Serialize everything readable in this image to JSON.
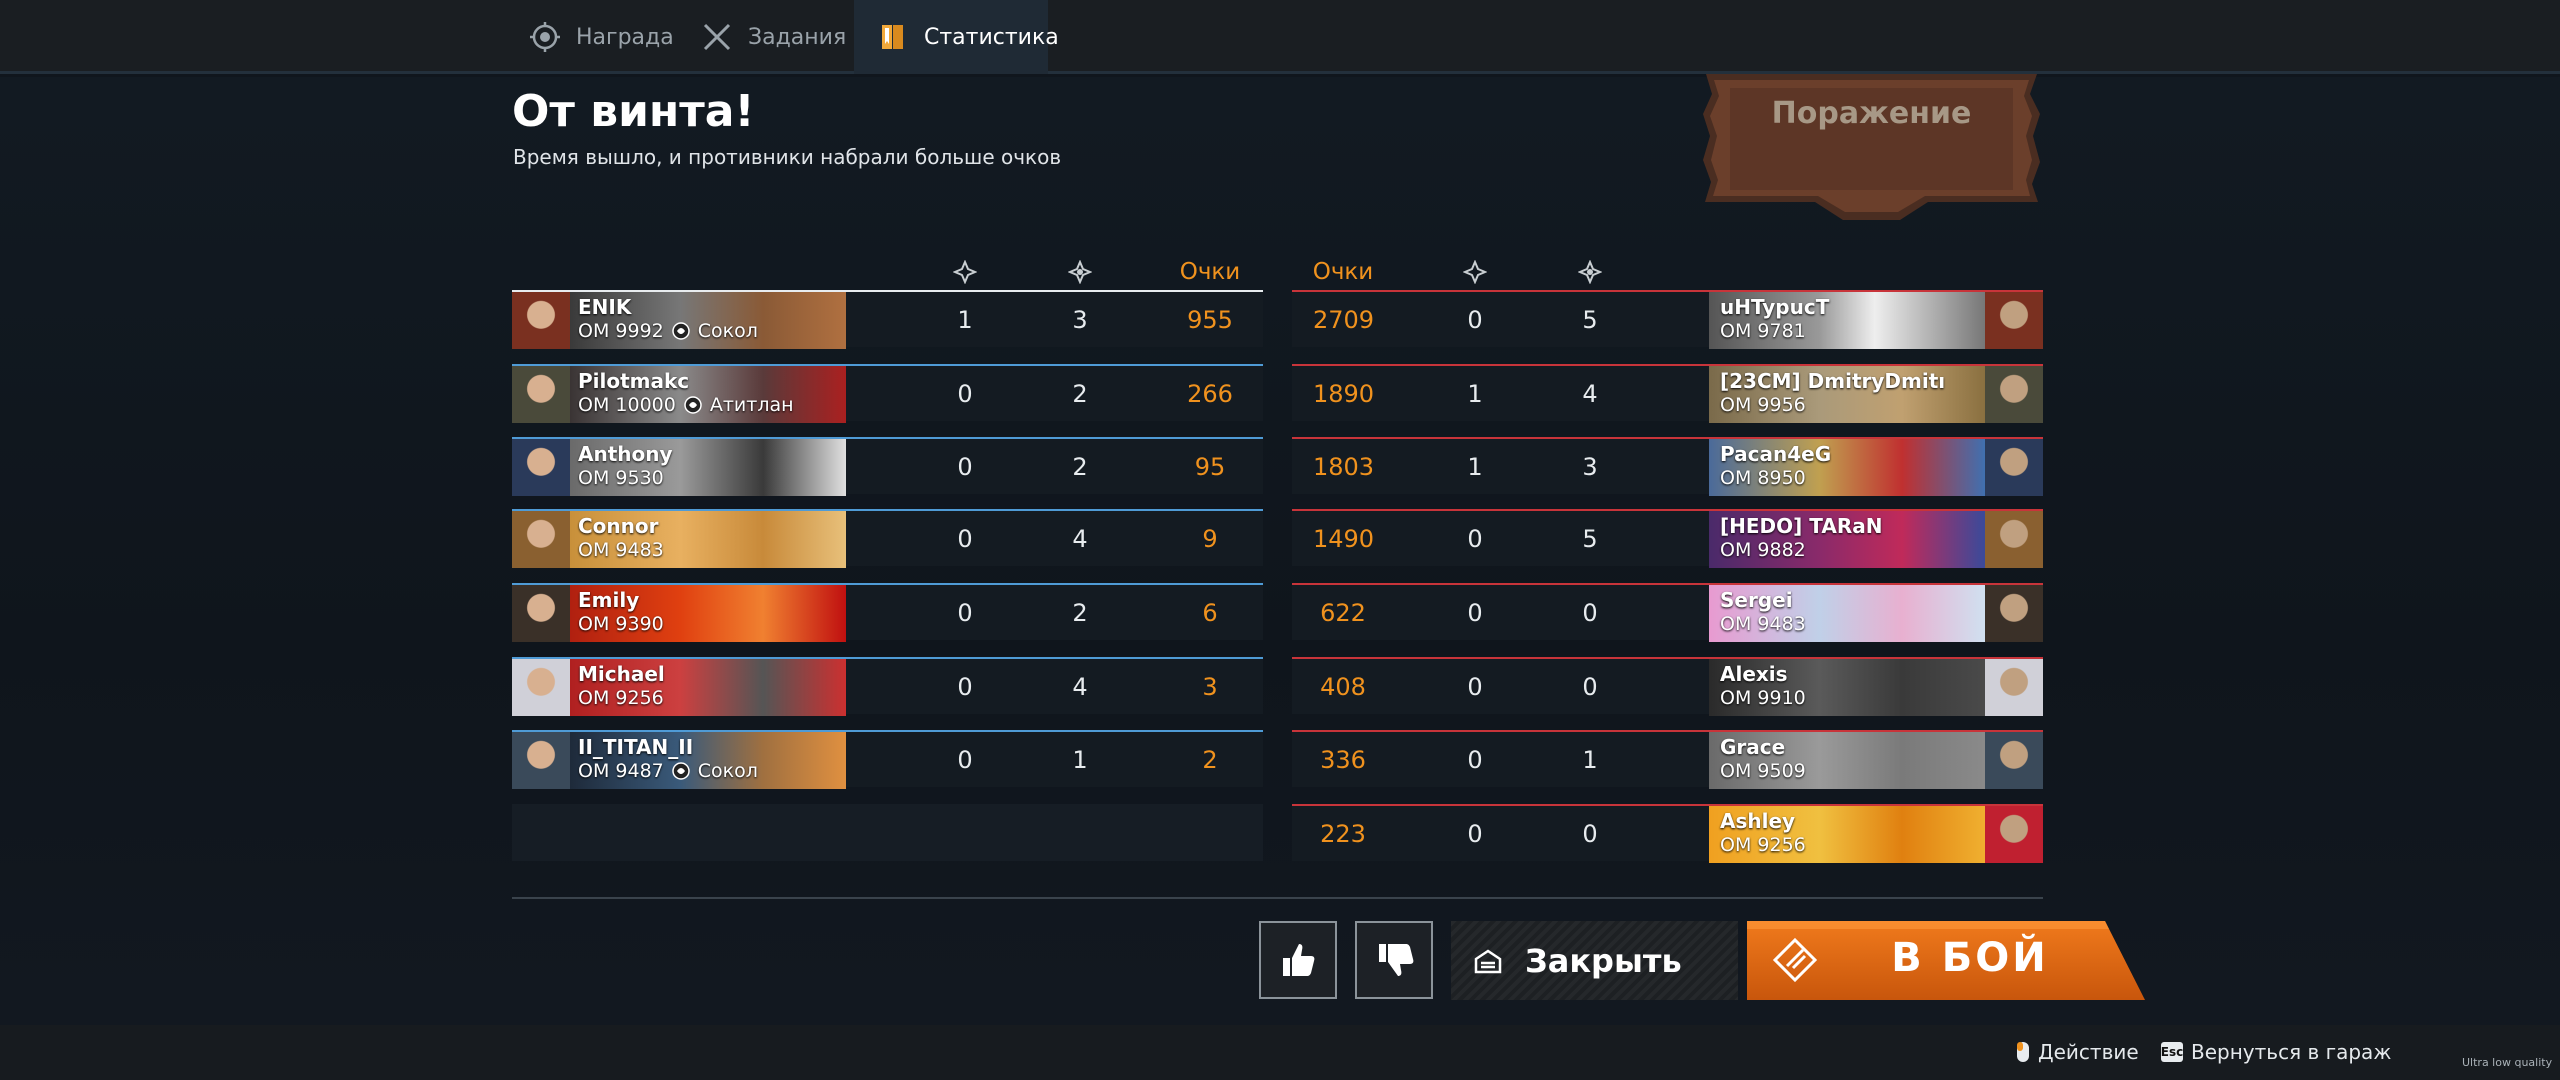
{
  "tabs": [
    {
      "label": "Награда",
      "icon": "award-icon"
    },
    {
      "label": "Задания",
      "icon": "crossed-swords-icon"
    },
    {
      "label": "Статистика",
      "icon": "bookmarks-icon"
    }
  ],
  "header": {
    "title": "От винта!",
    "subtitle": "Время вышло, и противники набрали больше очков",
    "result": "Поражение"
  },
  "columns": {
    "kills_icon": "kills-icon",
    "deaths_icon": "deaths-icon",
    "points_label": "Очки"
  },
  "team_left": [
    {
      "name": "ENIK",
      "rating": "ОМ 9992",
      "clan": "Сокол",
      "clan_icon": "falcon-clan-icon",
      "a": "1",
      "b": "3",
      "points": "955"
    },
    {
      "name": "Pilotmakc",
      "rating": "ОМ 10000",
      "clan": "Атитлан",
      "clan_icon": "atitlan-clan-icon",
      "a": "0",
      "b": "2",
      "points": "266"
    },
    {
      "name": "Anthony",
      "rating": "ОМ 9530",
      "clan": "",
      "a": "0",
      "b": "2",
      "points": "95"
    },
    {
      "name": "Connor",
      "rating": "ОМ 9483",
      "clan": "",
      "a": "0",
      "b": "4",
      "points": "9"
    },
    {
      "name": "Emily",
      "rating": "ОМ 9390",
      "clan": "",
      "a": "0",
      "b": "2",
      "points": "6"
    },
    {
      "name": "Michael",
      "rating": "ОМ 9256",
      "clan": "",
      "a": "0",
      "b": "4",
      "points": "3"
    },
    {
      "name": "II_TITAN_II",
      "rating": "ОМ 9487",
      "clan": "Сокол",
      "clan_icon": "falcon-clan-icon",
      "a": "0",
      "b": "1",
      "points": "2"
    }
  ],
  "team_right": [
    {
      "name": "uHTypucT",
      "rating": "ОМ 9781",
      "points": "2709",
      "a": "0",
      "b": "5"
    },
    {
      "name": "[23CM] DmitryDmitı",
      "rating": "ОМ 9956",
      "points": "1890",
      "a": "1",
      "b": "4"
    },
    {
      "name": "Pacan4eG",
      "rating": "ОМ 8950",
      "points": "1803",
      "a": "1",
      "b": "3"
    },
    {
      "name": "[HEDO] TARaN",
      "rating": "ОМ 9882",
      "points": "1490",
      "a": "0",
      "b": "5"
    },
    {
      "name": "Sergei",
      "rating": "ОМ 9483",
      "points": "622",
      "a": "0",
      "b": "0"
    },
    {
      "name": "Alexis",
      "rating": "ОМ 9910",
      "points": "408",
      "a": "0",
      "b": "0"
    },
    {
      "name": "Grace",
      "rating": "ОМ 9509",
      "points": "336",
      "a": "0",
      "b": "1"
    },
    {
      "name": "Ashley",
      "rating": "ОМ 9256",
      "points": "223",
      "a": "0",
      "b": "0"
    }
  ],
  "actions": {
    "like_icon": "thumbs-up-icon",
    "dislike_icon": "thumbs-down-icon",
    "close_label": "Закрыть",
    "close_icon": "garage-icon",
    "fight_label": "В БОЙ",
    "fight_icon": "fight-diamond-icon"
  },
  "footer": {
    "hint_action": "Действие",
    "hint_action_icon": "mouse-icon",
    "hint_back_key": "Esc",
    "hint_back": "Вернуться в гараж",
    "quality": "Ultra low quality"
  },
  "colors": {
    "accent_orange": "#f0921e",
    "team_left_line": "#4f9bd6",
    "team_right_line": "#c8343a"
  }
}
